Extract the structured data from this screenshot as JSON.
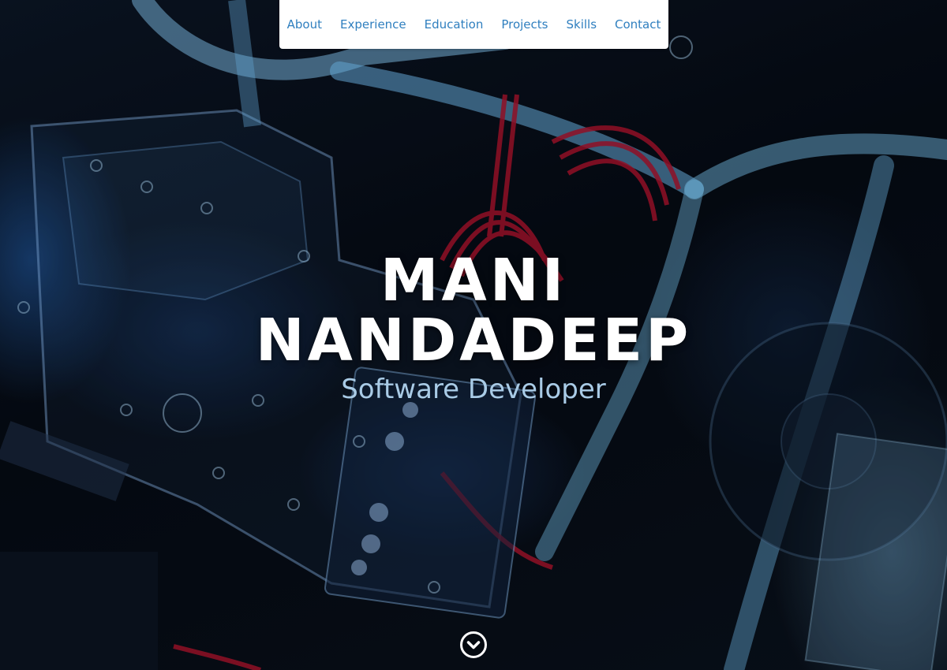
{
  "nav": {
    "items": [
      {
        "label": "About"
      },
      {
        "label": "Experience"
      },
      {
        "label": "Education"
      },
      {
        "label": "Projects"
      },
      {
        "label": "Skills"
      },
      {
        "label": "Contact"
      }
    ]
  },
  "masthead": {
    "name_first": "MANI",
    "name_last": "NANDADEEP",
    "subtitle": "Software Developer",
    "scroll_icon": "chevron-down-circle-icon"
  },
  "colors": {
    "nav_link": "#2f7fbf",
    "nav_background": "#ffffff",
    "heading": "#ffffff",
    "subtitle": "#a9cbe6"
  }
}
